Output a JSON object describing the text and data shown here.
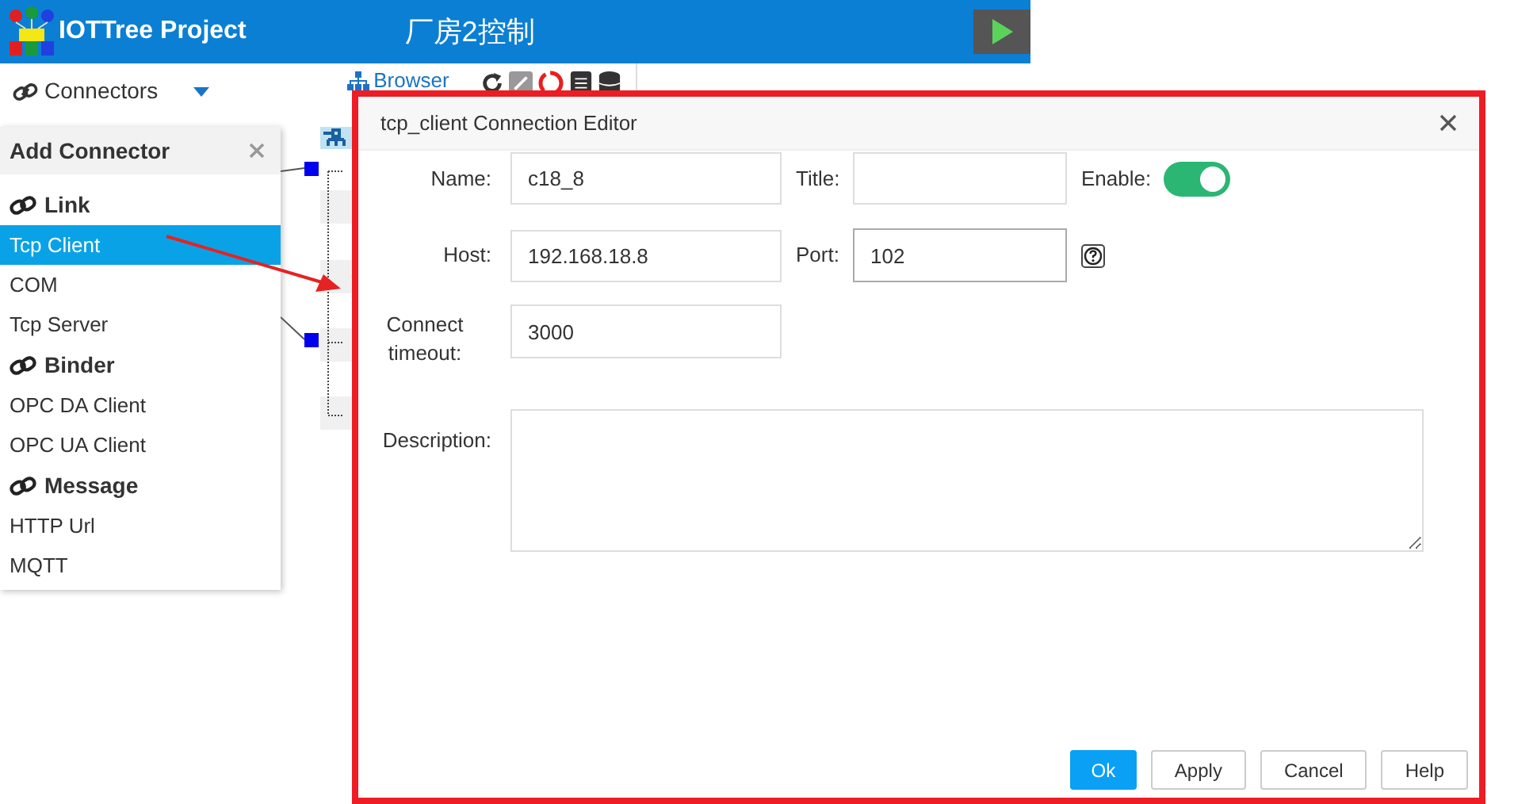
{
  "app": {
    "title": "IOTTree Project",
    "project": "厂房2控制"
  },
  "toolbar": {
    "connectors": "Connectors",
    "browser": "Browser"
  },
  "add_connector": {
    "title": "Add Connector",
    "groups": [
      {
        "label": "Link",
        "items": [
          {
            "label": "Tcp Client",
            "selected": true
          },
          {
            "label": "COM",
            "selected": false
          },
          {
            "label": "Tcp Server",
            "selected": false
          }
        ]
      },
      {
        "label": "Binder",
        "items": [
          {
            "label": "OPC DA Client",
            "selected": false
          },
          {
            "label": "OPC UA Client",
            "selected": false
          }
        ]
      },
      {
        "label": "Message",
        "items": [
          {
            "label": "HTTP Url",
            "selected": false
          },
          {
            "label": "MQTT",
            "selected": false
          }
        ]
      }
    ]
  },
  "dialog": {
    "title": "tcp_client Connection Editor",
    "name": {
      "label": "Name:",
      "value": "c18_8"
    },
    "title_field": {
      "label": "Title:"
    },
    "enable": {
      "label": "Enable:",
      "on": true
    },
    "host": {
      "label": "Host:",
      "value": "192.168.18.8"
    },
    "port": {
      "label": "Port:",
      "value": "102"
    },
    "timeout": {
      "label": "Connect timeout:",
      "value": "3000"
    },
    "description": {
      "label": "Description:"
    },
    "buttons": [
      {
        "label": "Ok",
        "kind": "primary"
      },
      {
        "label": "Apply",
        "kind": "default"
      },
      {
        "label": "Cancel",
        "kind": "default"
      },
      {
        "label": "Help",
        "kind": "default"
      }
    ]
  }
}
